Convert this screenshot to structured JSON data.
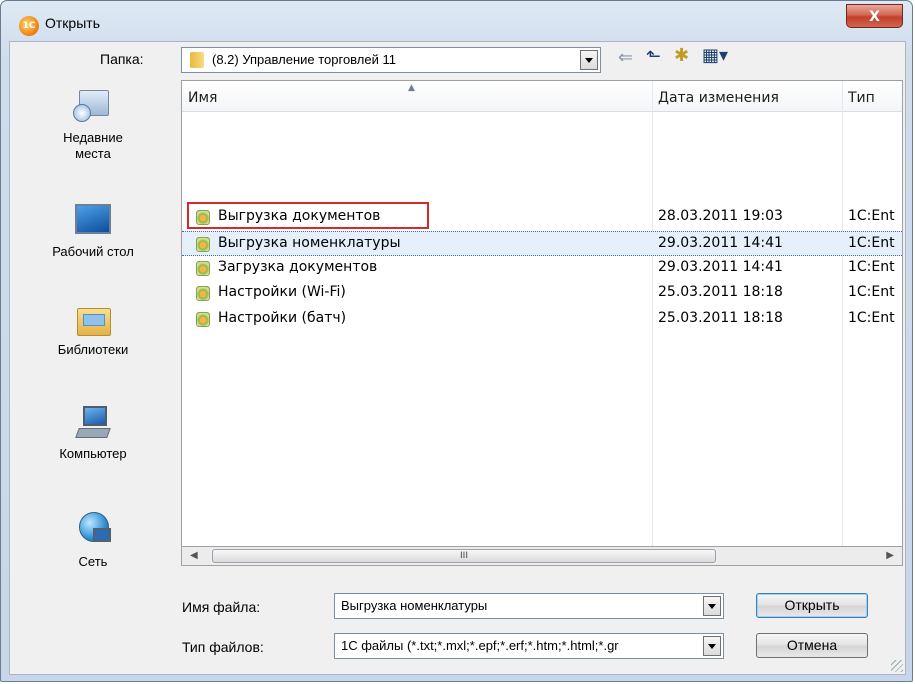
{
  "window": {
    "title": "Открыть",
    "app_icon_text": "1С",
    "close_label": "X"
  },
  "toolbar": {
    "folder_label": "Папка:",
    "folder_value": "(8.2) Управление торговлей 11",
    "icons": [
      "back-arrow-icon",
      "up-folder-icon",
      "new-folder-icon",
      "view-menu-icon"
    ]
  },
  "places": [
    {
      "label": "Недавние места",
      "icon": "recent-places-icon"
    },
    {
      "label": "Рабочий стол",
      "icon": "desktop-icon"
    },
    {
      "label": "Библиотеки",
      "icon": "libraries-icon"
    },
    {
      "label": "Компьютер",
      "icon": "computer-icon"
    },
    {
      "label": "Сеть",
      "icon": "network-icon"
    }
  ],
  "list": {
    "columns": [
      "Имя",
      "Дата изменения",
      "Тип"
    ],
    "rows": [
      {
        "name": "Выгрузка документов",
        "date": "28.03.2011 19:03",
        "type": "1C:Ent"
      },
      {
        "name": "Выгрузка номенклатуры",
        "date": "29.03.2011 14:41",
        "type": "1C:Ent"
      },
      {
        "name": "Загрузка документов",
        "date": "29.03.2011 14:41",
        "type": "1C:Ent"
      },
      {
        "name": "Настройки (Wi-Fi)",
        "date": "25.03.2011 18:18",
        "type": "1C:Ent"
      },
      {
        "name": "Настройки (батч)",
        "date": "25.03.2011 18:18",
        "type": "1C:Ent"
      }
    ],
    "selected_index": 1,
    "highlighted_index": 0,
    "scroll_thumb_text": "III"
  },
  "footer": {
    "filename_label": "Имя файла:",
    "filename_value": "Выгрузка номенклатуры",
    "filetype_label": "Тип файлов:",
    "filetype_value": "1С файлы (*.txt;*.mxl;*.epf;*.erf;*.htm;*.html;*.gr",
    "open_button": "Открыть",
    "cancel_button": "Отмена"
  },
  "colors": {
    "highlight_box": "#d32a2a",
    "selection_bg": "#e6f0fb",
    "close_button": "#c2402c"
  }
}
